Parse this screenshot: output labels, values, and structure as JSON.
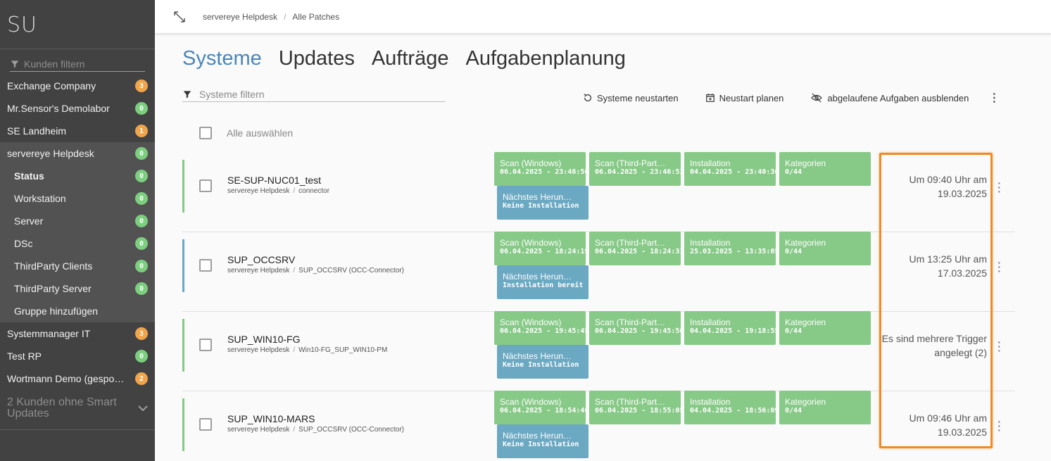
{
  "sidebar": {
    "logo": "SU",
    "filter_placeholder": "Kunden filtern",
    "items": [
      {
        "label": "Exchange Company",
        "badge": "3",
        "badge_color": "orange",
        "type": "top"
      },
      {
        "label": "Mr.Sensor's Demolabor",
        "badge": "0",
        "badge_color": "green",
        "type": "top"
      },
      {
        "label": "SE Landheim",
        "badge": "1",
        "badge_color": "orange",
        "type": "top"
      },
      {
        "label": "servereye Helpdesk",
        "badge": "0",
        "badge_color": "green",
        "type": "active"
      },
      {
        "label": "Status",
        "badge": "0",
        "badge_color": "green",
        "type": "sub-bold"
      },
      {
        "label": "Workstation",
        "badge": "0",
        "badge_color": "green",
        "type": "sub"
      },
      {
        "label": "Server",
        "badge": "0",
        "badge_color": "green",
        "type": "sub"
      },
      {
        "label": "DSc",
        "badge": "0",
        "badge_color": "green",
        "type": "sub"
      },
      {
        "label": "ThirdParty Clients",
        "badge": "0",
        "badge_color": "green",
        "type": "sub"
      },
      {
        "label": "ThirdParty Server",
        "badge": "0",
        "badge_color": "green",
        "type": "sub"
      },
      {
        "label": "Gruppe hinzufügen",
        "badge": "",
        "badge_color": "",
        "type": "sub"
      },
      {
        "label": "Systemmanager IT",
        "badge": "3",
        "badge_color": "orange",
        "type": "top"
      },
      {
        "label": "Test RP",
        "badge": "0",
        "badge_color": "green",
        "type": "top"
      },
      {
        "label": "Wortmann Demo (gespo…",
        "badge": "2",
        "badge_color": "orange",
        "type": "top"
      }
    ],
    "more_label": "2 Kunden ohne Smart Updates"
  },
  "topbar": {
    "breadcrumb": [
      "servereye Helpdesk",
      "Alle Patches"
    ],
    "separator": "/"
  },
  "tabs": [
    "Systeme",
    "Updates",
    "Aufträge",
    "Aufgabenplanung"
  ],
  "filter_placeholder": "Systeme filtern",
  "toolbar": {
    "restart": "Systeme neustarten",
    "plan": "Neustart planen",
    "hide": "abgelaufene Aufgaben ausblenden",
    "more": "⋮"
  },
  "select_all": "Alle auswählen",
  "rows": [
    {
      "name": "SE-SUP-NUC01_test",
      "path": [
        "servereye Helpdesk",
        "connector"
      ],
      "bar_color": "#87c987",
      "tiles": [
        {
          "title": "Scan (Windows)",
          "value": "06.04.2025 - 23:46:50"
        },
        {
          "title": "Scan (Third-Part…",
          "value": "06.04.2025 - 23:46:53"
        },
        {
          "title": "Installation",
          "value": "04.04.2025 - 23:40:30"
        },
        {
          "title": "Kategorien",
          "value": "0/44"
        }
      ],
      "next": {
        "title": "Nächstes Herun…",
        "value": "Keine Installation"
      },
      "trigger": "Um 09:40 Uhr am 19.03.2025"
    },
    {
      "name": "SUP_OCCSRV",
      "path": [
        "servereye Helpdesk",
        "SUP_OCCSRV (OCC-Connector)"
      ],
      "bar_color": "#6ba8c2",
      "tiles": [
        {
          "title": "Scan (Windows)",
          "value": "06.04.2025 - 18:24:19"
        },
        {
          "title": "Scan (Third-Part…",
          "value": "06.04.2025 - 18:24:31"
        },
        {
          "title": "Installation",
          "value": "25.03.2025 - 13:35:05"
        },
        {
          "title": "Kategorien",
          "value": "0/44"
        }
      ],
      "next": {
        "title": "Nächstes Herun…",
        "value": "Installation bereit"
      },
      "trigger": "Um 13:25 Uhr am 17.03.2025"
    },
    {
      "name": "SUP_WIN10-FG",
      "path": [
        "servereye Helpdesk",
        "Win10-FG_SUP_WIN10-PM"
      ],
      "bar_color": "#87c987",
      "tiles": [
        {
          "title": "Scan (Windows)",
          "value": "06.04.2025 - 19:45:45"
        },
        {
          "title": "Scan (Third-Part…",
          "value": "06.04.2025 - 19:45:50"
        },
        {
          "title": "Installation",
          "value": "04.04.2025 - 19:18:55"
        },
        {
          "title": "Kategorien",
          "value": "0/44"
        }
      ],
      "next": {
        "title": "Nächstes Herun…",
        "value": "Keine Installation"
      },
      "trigger": "Es sind mehrere Trigger angelegt (2)"
    },
    {
      "name": "SUP_WIN10-MARS",
      "path": [
        "servereye Helpdesk",
        "SUP_OCCSRV (OCC-Connector)"
      ],
      "bar_color": "#87c987",
      "tiles": [
        {
          "title": "Scan (Windows)",
          "value": "06.04.2025 - 18:54:46"
        },
        {
          "title": "Scan (Third-Part…",
          "value": "06.04.2025 - 18:55:05"
        },
        {
          "title": "Installation",
          "value": "04.04.2025 - 18:56:09"
        },
        {
          "title": "Kategorien",
          "value": "0/44"
        }
      ],
      "next": {
        "title": "Nächstes Herun…",
        "value": "Keine Installation"
      },
      "trigger": "Um 09:46 Uhr am 19.03.2025"
    }
  ],
  "colors": {
    "tab_active": "#4a86b8",
    "tile_green": "#87c987",
    "tile_blue": "#6ba8c2",
    "highlight": "#f08a24"
  }
}
